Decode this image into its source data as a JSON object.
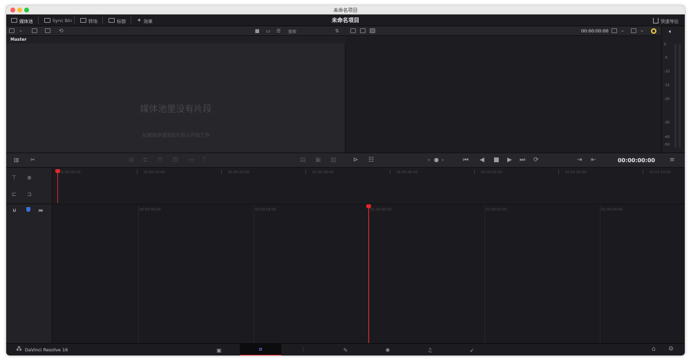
{
  "window": {
    "title": "未命名项目",
    "project_title": "未命名项目"
  },
  "toolbar": {
    "media_pool": "媒体池",
    "sync_bin": "Sync Bin",
    "transitions": "转场",
    "titles": "标题",
    "effects": "效果",
    "quick_export": "快速导出"
  },
  "media_pool": {
    "search_placeholder": "搜索",
    "bin_name": "Master",
    "empty_title": "媒体池里没有片段",
    "empty_hint": "从媒体存储添加片段以开始工作"
  },
  "viewer": {
    "timecode": "00:00:00:00"
  },
  "audio_meter": {
    "scale": [
      "0",
      "-5",
      "-10",
      "-15",
      "-20",
      "-30",
      "-40",
      "-50"
    ]
  },
  "transport": {
    "timecode": "00:00:00:00"
  },
  "upper_ruler": {
    "ticks": [
      "01:00:00:00",
      "01:00:10:00",
      "01:00:20:00",
      "01:00:30:00",
      "01:00:40:00",
      "01:00:50:00",
      "01:01:00:00",
      "01:01:10:00"
    ]
  },
  "lower_ruler": {
    "ticks": [
      "00:59:56:00",
      "00:59:58:00",
      "01:00:00:00",
      "01:00:02:00",
      "01:00:04:00"
    ]
  },
  "footer": {
    "app_name": "DaVinci Resolve 16",
    "pages": [
      "media-page",
      "cut-page",
      "edit-page",
      "fusion-page",
      "color-page",
      "fairlight-page",
      "deliver-page"
    ],
    "active_page": "cut-page"
  },
  "colors": {
    "accent": "#e5262b",
    "active_page": "#7b8bff",
    "background": "#1f1f23"
  }
}
